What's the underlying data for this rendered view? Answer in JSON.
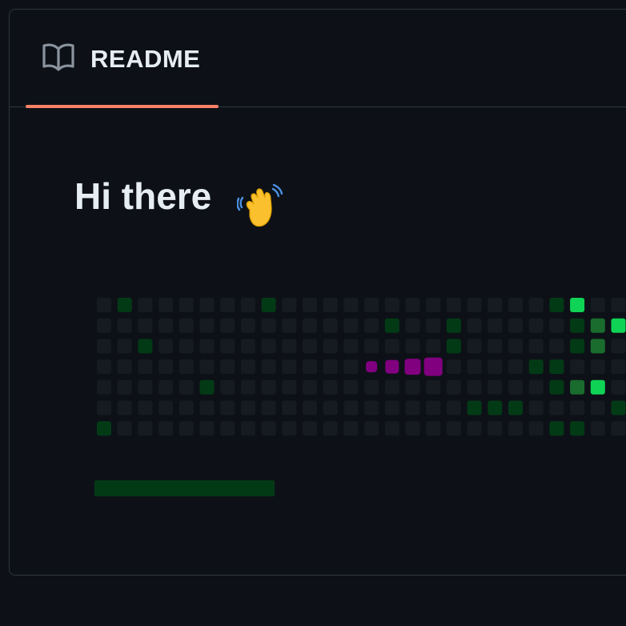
{
  "tab": {
    "label": "README",
    "icon": "book-icon"
  },
  "title": {
    "text": "Hi there",
    "emoji_icon": "waving-hand-icon"
  },
  "contribution_graph": {
    "colors": {
      "0": "#161b22",
      "1": "#033a16",
      "2": "#196c2e",
      "3": "#2ea043",
      "4": "#0fd355",
      "snake": "#800080"
    },
    "rows": [
      "01000000100000000000001400",
      "00000000000000100100000124",
      "00100000000000000100000120",
      "0000000000000000000001100",
      "00000100000000000000001240",
      "00000000000000000011100001",
      "10000000000000000000001100"
    ],
    "snake_positions": [
      13,
      14,
      15,
      16
    ],
    "snake_row": 3
  },
  "progress": {
    "fraction": 1
  },
  "colors": {
    "accent": "#f78166",
    "text": "#e6edf3",
    "border": "#30363d",
    "background": "#0d1117"
  }
}
